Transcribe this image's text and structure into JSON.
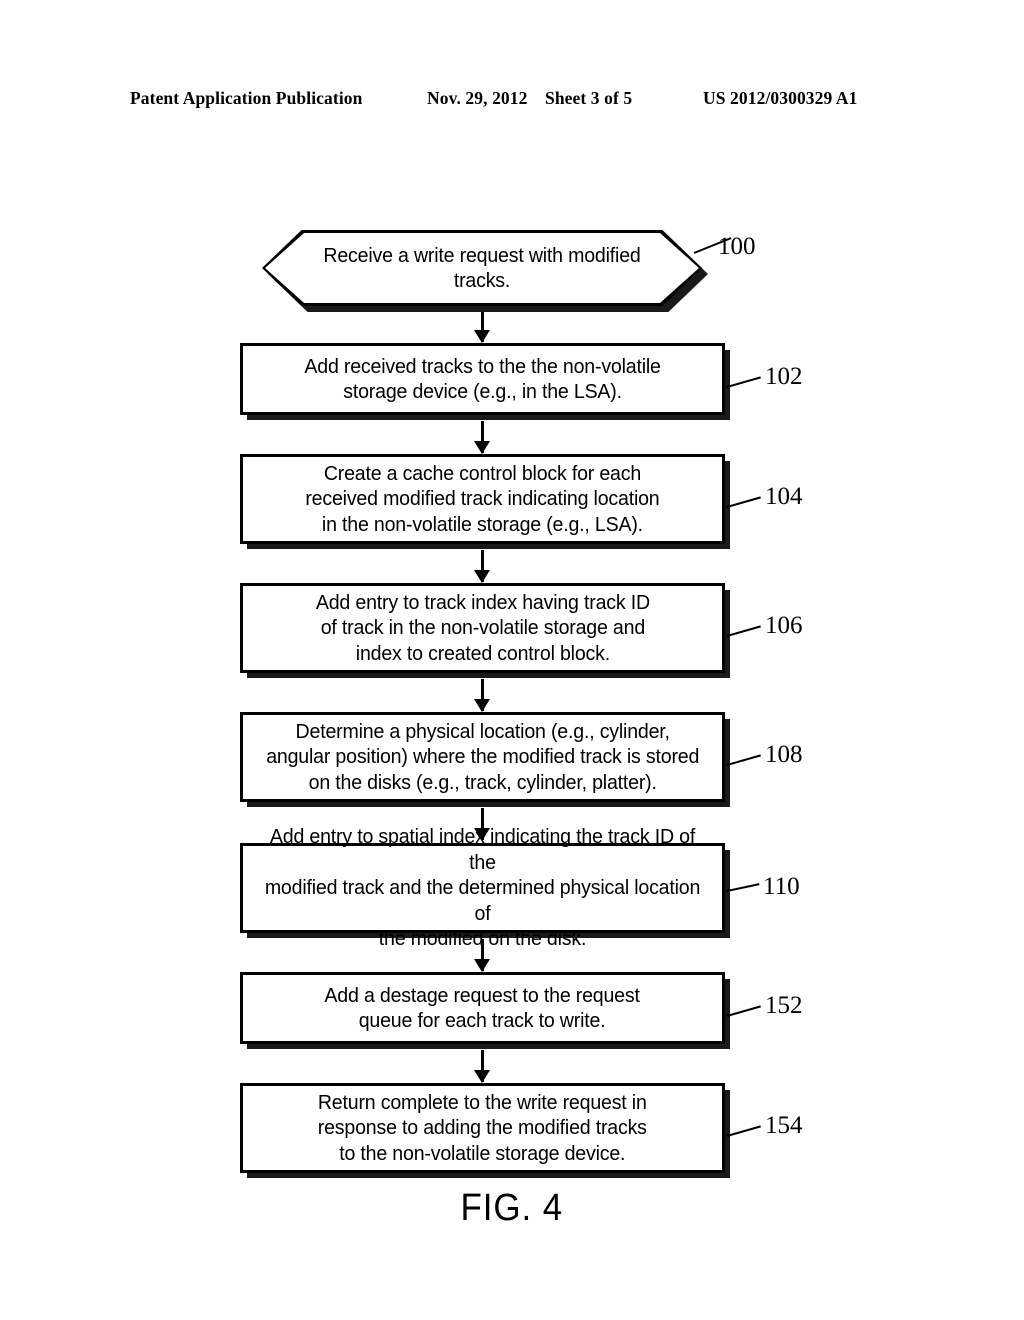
{
  "header": {
    "publication": "Patent Application Publication",
    "date": "Nov. 29, 2012",
    "sheet": "Sheet 3 of 5",
    "patent_number": "US 2012/0300329 A1"
  },
  "figure": {
    "caption": "FIG. 4",
    "type": "flowchart",
    "colors": {
      "line": "#000000",
      "shadow": "#1a1a1a",
      "fill": "#ffffff"
    }
  },
  "flowchart": {
    "nodes": [
      {
        "ref": "100",
        "shape": "hexagon",
        "text": "Receive a write request with modified\ntracks."
      },
      {
        "ref": "102",
        "shape": "rectangle",
        "text": "Add received tracks to the the non-volatile\nstorage device (e.g., in the LSA)."
      },
      {
        "ref": "104",
        "shape": "rectangle",
        "text": "Create a cache control block for each\nreceived modified track indicating location\nin the non-volatile storage (e.g., LSA)."
      },
      {
        "ref": "106",
        "shape": "rectangle",
        "text": "Add entry to track index having track ID\nof track in the non-volatile storage and\nindex to created control block."
      },
      {
        "ref": "108",
        "shape": "rectangle",
        "text": "Determine a physical location (e.g., cylinder,\nangular position) where the modified track is stored\non the disks (e.g., track, cylinder, platter)."
      },
      {
        "ref": "110",
        "shape": "rectangle",
        "text": "Add entry to spatial index indicating the track ID of the\nmodified track and the determined physical location of\nthe modified on the disk."
      },
      {
        "ref": "152",
        "shape": "rectangle",
        "text": "Add a destage request to the request\nqueue for each track to write."
      },
      {
        "ref": "154",
        "shape": "rectangle",
        "text": "Return complete to the write request in\nresponse to adding the modified tracks\nto the non-volatile storage device."
      }
    ]
  }
}
